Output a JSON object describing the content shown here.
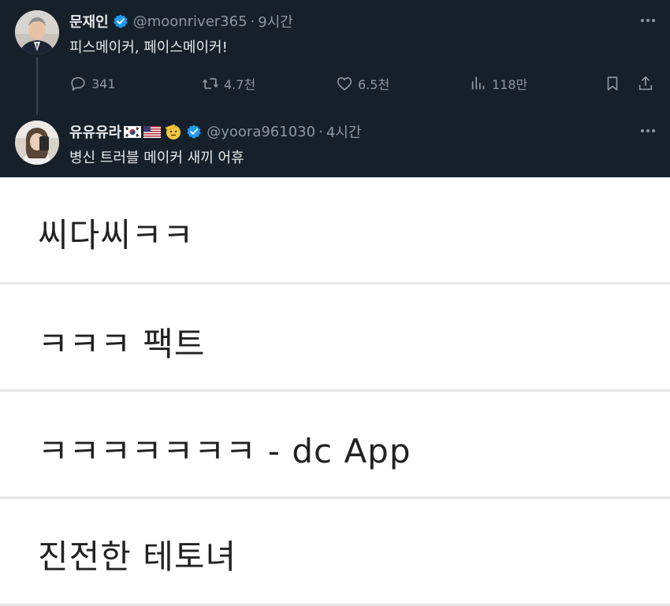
{
  "tweets": [
    {
      "author": "문재인",
      "verified": true,
      "handle": "@moonriver365",
      "separator": "·",
      "time": "9시간",
      "text": "피스메이커, 페이스메이커!",
      "stats": {
        "replies": "341",
        "retweets": "4.7천",
        "likes": "6.5천",
        "views": "118만"
      }
    },
    {
      "author": "유유유라",
      "flags": [
        "south-korea-flag",
        "usa-flag"
      ],
      "emoji": "saluting-face-emoji",
      "verified": true,
      "handle": "@yoora961030",
      "separator": "·",
      "time": "4시간",
      "text": "병신 트러블 메이커 새끼 어휴"
    }
  ],
  "comments": [
    "씨다씨ㅋㅋ",
    "ㅋㅋㅋ 팩트",
    "ㅋㅋㅋㅋㅋㅋㅋ - dc App",
    "진전한 테토녀"
  ],
  "colors": {
    "tweet_background": "#15202b",
    "primary_text": "#e7e9ea",
    "secondary_text": "#8b98a5",
    "verified_badge": "#1d9bf0",
    "comment_text": "#222222",
    "comment_divider": "#e6e6e6"
  },
  "icons": [
    "more-icon",
    "reply-icon",
    "retweet-icon",
    "like-icon",
    "views-icon",
    "bookmark-icon",
    "share-icon",
    "verified-badge-icon"
  ]
}
